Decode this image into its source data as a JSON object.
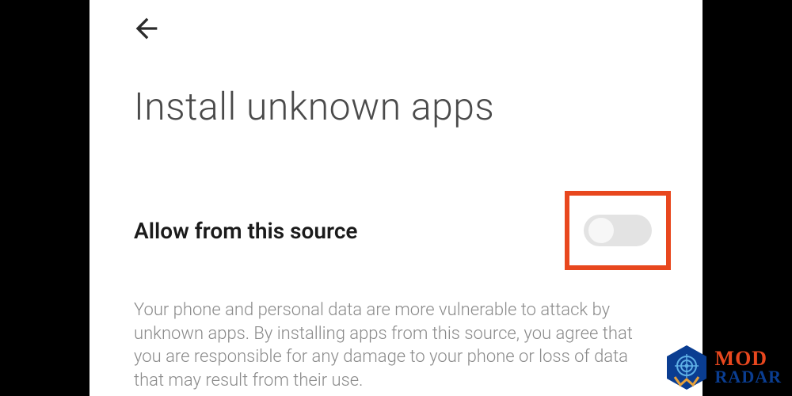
{
  "header": {
    "title": "Install unknown apps"
  },
  "setting": {
    "label": "Allow from this source",
    "toggle_state": "off"
  },
  "description": "Your phone and personal data are more vulnerable to attack by unknown apps. By installing apps from this source, you agree that you are responsible for any damage to your phone or loss of data that may result from their use.",
  "watermark": {
    "line1": "MOD",
    "line2": "RADAR"
  },
  "highlight_color": "#e8471e"
}
